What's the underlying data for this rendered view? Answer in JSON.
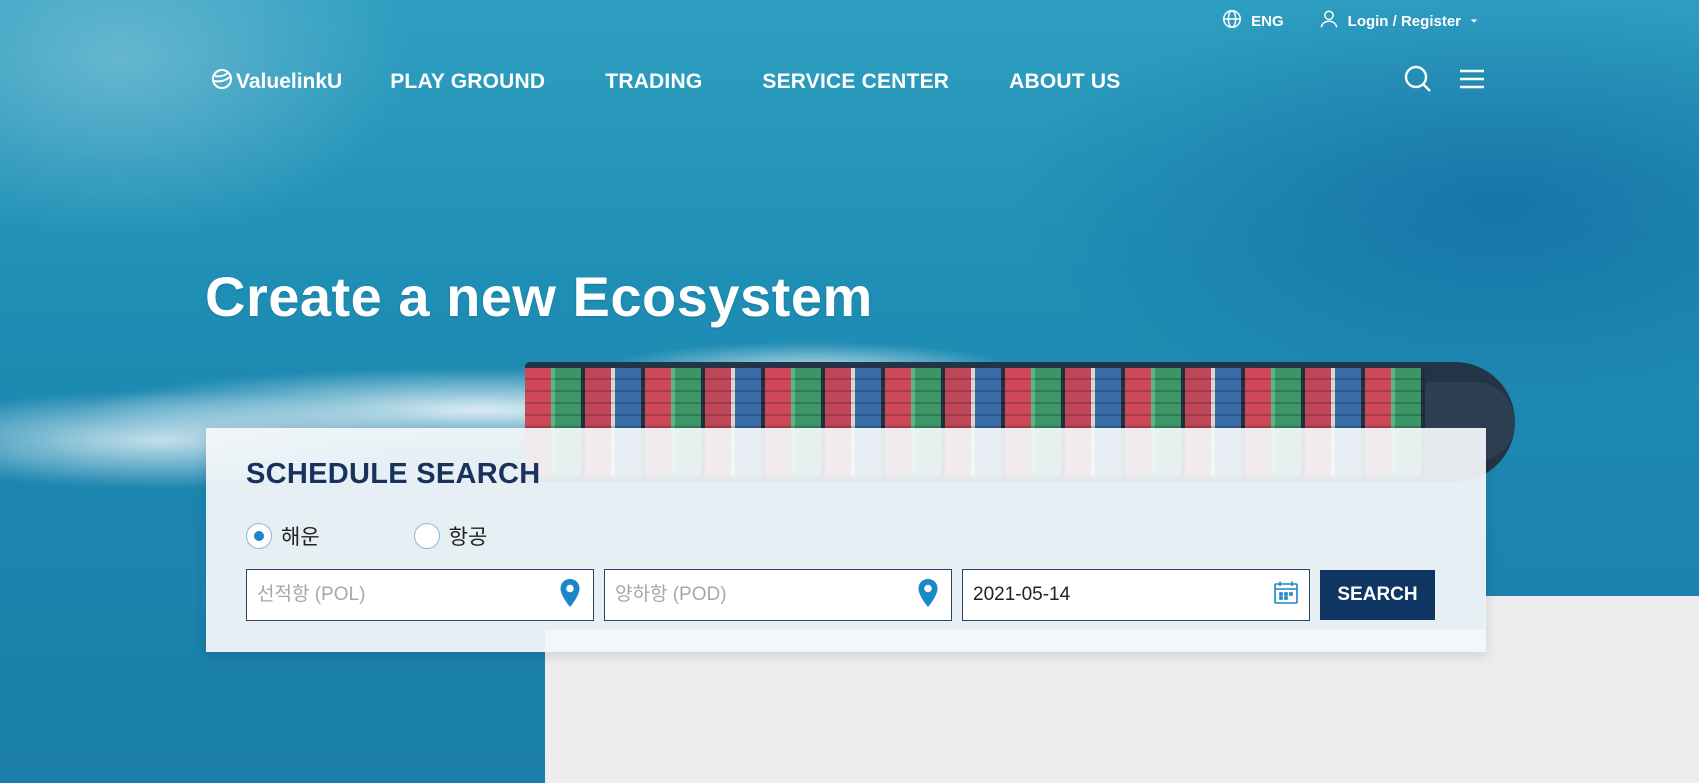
{
  "util": {
    "language": "ENG",
    "login": "Login / Register"
  },
  "brand": {
    "logo_text": "ValuelinkU"
  },
  "nav": {
    "items": [
      "PLAY GROUND",
      "TRADING",
      "SERVICE CENTER",
      "ABOUT US"
    ]
  },
  "hero": {
    "headline": "Create a new Ecosystem"
  },
  "schedule": {
    "title": "SCHEDULE SEARCH",
    "modes": [
      {
        "label": "해운",
        "selected": true
      },
      {
        "label": "항공",
        "selected": false
      }
    ],
    "pol_placeholder": "선적항 (POL)",
    "pod_placeholder": "양하항 (POD)",
    "date_value": "2021-05-14",
    "search_label": "SEARCH"
  },
  "colors": {
    "accent": "#0f3563",
    "pin": "#1b86c8",
    "title": "#18325c"
  },
  "icons": {
    "language": "globe-icon",
    "login": "user-icon",
    "search": "search-icon",
    "menu": "hamburger-icon",
    "pol": "map-pin-icon",
    "pod": "map-pin-icon",
    "date": "calendar-icon"
  }
}
